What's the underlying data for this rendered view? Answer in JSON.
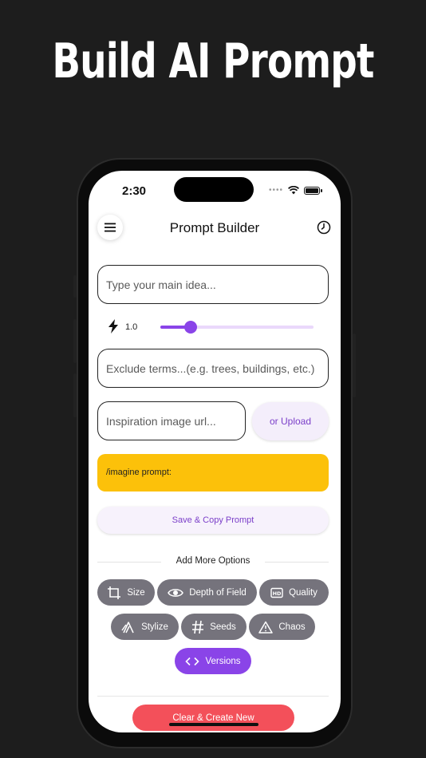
{
  "headline": "Build AI Prompt",
  "status_bar": {
    "time": "2:30"
  },
  "header": {
    "title": "Prompt Builder"
  },
  "form": {
    "main_idea_placeholder": "Type your main idea...",
    "weight_value": "1.0",
    "weight_level_fraction": 0.2,
    "exclude_placeholder": "Exclude terms...(e.g. trees, buildings, etc.)",
    "image_url_placeholder": "Inspiration image url...",
    "upload_label": "or Upload",
    "prompt_preview": "/imagine prompt:",
    "save_label": "Save & Copy Prompt"
  },
  "options": {
    "heading": "Add More Options",
    "chips": [
      {
        "label": "Size",
        "icon": "crop-icon"
      },
      {
        "label": "Depth of Field",
        "icon": "eye-icon"
      },
      {
        "label": "Quality",
        "icon": "hd-icon"
      },
      {
        "label": "Stylize",
        "icon": "brush-icon"
      },
      {
        "label": "Seeds",
        "icon": "hash-icon"
      },
      {
        "label": "Chaos",
        "icon": "warning-icon"
      },
      {
        "label": "Versions",
        "icon": "code-icon"
      }
    ]
  },
  "footer": {
    "clear_label": "Clear & Create New"
  },
  "colors": {
    "accent": "#8a44e8",
    "prompt_bg": "#fcc10a",
    "danger": "#f3505a",
    "chip": "#75737c"
  }
}
